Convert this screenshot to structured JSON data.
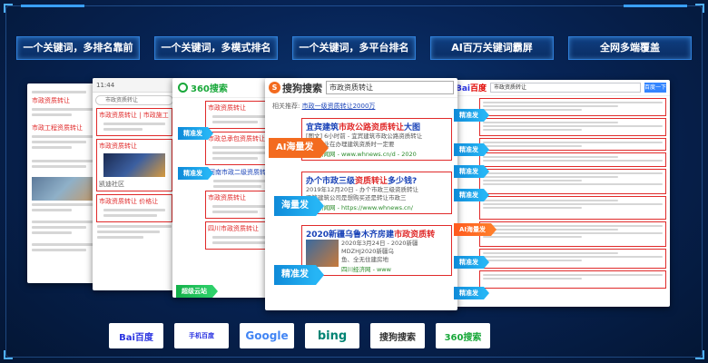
{
  "features": [
    "一个关键词，多排名靠前",
    "一个关键词，多模式排名",
    "一个关键词，多平台排名",
    "AI百万关键词霸屏",
    "全网多端覆盖"
  ],
  "panels": {
    "left1": {
      "line1": "市政资质转让",
      "line2": "市政工程资质转让"
    },
    "left2": {
      "status": "11:44",
      "search": "市政资质转让",
      "item1": "市政资质转让 | 市政施工",
      "item2": "市政资质转让",
      "item3": "市政资质转让 价格让",
      "caption": "凯迪社区"
    },
    "p360": {
      "logo": "360搜索",
      "r1": "市政资质转让",
      "r2": "市政总承包资质转让",
      "r3": "河南市政二级资质转让",
      "r4": "市政资质转让",
      "r5": "四川市政资质转让"
    },
    "sogou": {
      "logo": "搜狗搜索",
      "query": "市政资质转让",
      "related_label": "相关推荐:",
      "related_link": "市政一级资质转让2000万",
      "results": [
        {
          "title_pre": "宜宾建筑",
          "title_hl": "市政公路资质转让",
          "title_post": "大图",
          "snip1": "[图文] 6小时前 - 宜宾建筑市政公路资质转让",
          "snip2": "建筑企业在办理建筑资质时一定要",
          "url": "威海新闻网 - www.whnews.cn/d - 2020"
        },
        {
          "title_pre": "办个市政三级",
          "title_hl": "资质转让",
          "title_post": "多少钱?",
          "snip1": "2019年12月20日 - 办个市政三级资质转让",
          "snip2": "不管建筑公司是想购买还是转让市政三",
          "url": "威海新闻网 - https://www.whnews.cn/"
        },
        {
          "title_pre": "2020新疆乌鲁木齐房建",
          "title_hl": "市政资质转",
          "title_post": "",
          "snip1": "2020年3月24日 - 2020新疆",
          "snip2": "MDZHJ2020新疆乌",
          "snip3": "鱼、全无住建房地",
          "url": "四川经济网 - www"
        }
      ]
    },
    "baidu": {
      "logo_a": "Bai",
      "logo_b": "百度",
      "query": "市政资质转让",
      "button": "百度一下"
    }
  },
  "tags": {
    "t360_1": "精准发",
    "t360_2": "精准发",
    "t360_3": "超级云站",
    "sogou_ai": "AI海量发",
    "sogou_mass": "海量发",
    "sogou_precise": "精准发",
    "baidu": [
      "精准发",
      "精准发",
      "精准发",
      "精准发",
      "AI海量发",
      "精准发",
      "精准发"
    ]
  },
  "engines": [
    "Bai百度",
    "手机百度",
    "Google",
    "bing",
    "搜狗搜索",
    "360搜索"
  ]
}
